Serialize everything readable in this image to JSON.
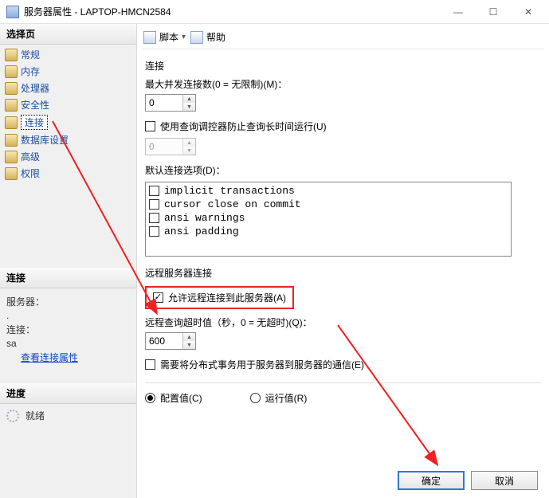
{
  "window": {
    "title": "服务器属性 - LAPTOP-HMCN2584"
  },
  "toolbar": {
    "script": "脚本",
    "help": "帮助"
  },
  "left": {
    "select_page": "选择页",
    "items": [
      "常规",
      "内存",
      "处理器",
      "安全性",
      "连接",
      "数据库设置",
      "高级",
      "权限"
    ],
    "conn_header": "连接",
    "server_label": "服务器：",
    "server_value": ".",
    "conn_label": "连接：",
    "conn_value": "sa",
    "view_props": "查看连接属性",
    "progress_header": "进度",
    "ready": "就绪"
  },
  "content": {
    "conn_section": "连接",
    "max_concurrent": "最大并发连接数(0 = 无限制)(M)：",
    "max_val": "0",
    "use_governor": "使用查询调控器防止查询长时间运行(U)",
    "gov_val": "0",
    "default_opts": "默认连接选项(D)：",
    "opts": [
      "implicit transactions",
      "cursor close on commit",
      "ansi warnings",
      "ansi padding"
    ],
    "remote_section": "远程服务器连接",
    "allow_remote": "允许远程连接到此服务器(A)",
    "remote_timeout": "远程查询超时值（秒，0 = 无超时)(Q)：",
    "timeout_val": "600",
    "distributed": "需要将分布式事务用于服务器到服务器的通信(E)",
    "configured": "配置值(C)",
    "running": "运行值(R)"
  },
  "buttons": {
    "ok": "确定",
    "cancel": "取消"
  }
}
